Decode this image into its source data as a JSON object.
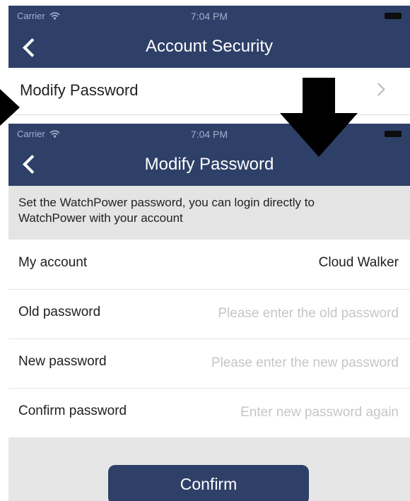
{
  "screen1": {
    "status_bar": {
      "carrier": "Carrier",
      "time": "7:04 PM"
    },
    "nav": {
      "title": "Account Security"
    },
    "row": {
      "label": "Modify Password"
    }
  },
  "screen2": {
    "status_bar": {
      "carrier": "Carrier",
      "time": "7:04 PM"
    },
    "nav": {
      "title": "Modify Password"
    },
    "info_text": "Set the WatchPower password, you can login directly to WatchPower with your account",
    "form": {
      "account": {
        "label": "My account",
        "value": "Cloud Walker"
      },
      "old_password": {
        "label": "Old password",
        "placeholder": "Please enter the old password"
      },
      "new_password": {
        "label": "New password",
        "placeholder": "Please enter the new password"
      },
      "confirm_password": {
        "label": "Confirm password",
        "placeholder": "Enter new password again"
      }
    },
    "confirm_button": "Confirm"
  },
  "colors": {
    "navbar": "#2e4068",
    "button": "#2e4068",
    "background_gray": "#e6e6e6",
    "placeholder": "#c6c6c6",
    "annotation_arrow": "#000000"
  },
  "icons": [
    "wifi-icon",
    "battery-icon",
    "back-chevron-icon",
    "chevron-right-icon",
    "down-arrow-icon",
    "right-arrow-icon"
  ]
}
